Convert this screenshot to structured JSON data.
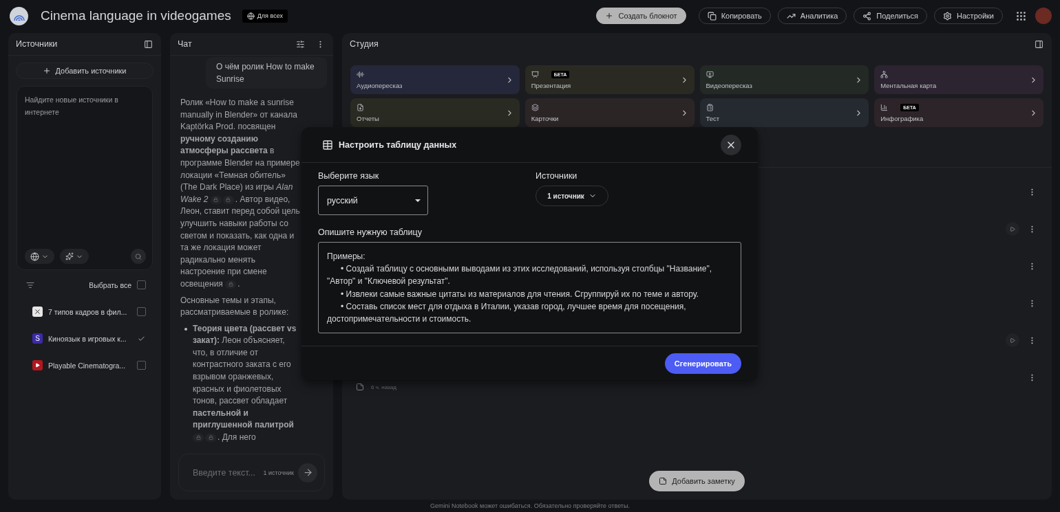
{
  "header": {
    "title": "Cinema language in videogames",
    "visibility": "Для всех",
    "create_button": "Создать блокнот",
    "actions": [
      {
        "kind": "copy",
        "label": "Копировать"
      },
      {
        "kind": "analytics",
        "label": "Аналитика"
      },
      {
        "kind": "share",
        "label": "Поделиться"
      },
      {
        "kind": "settings",
        "label": "Настройки"
      }
    ]
  },
  "sources": {
    "title": "Источники",
    "add_button": "Добавить источники",
    "search_placeholder": "Найдите новые источники в интернете",
    "select_all": {
      "label": "Выбрать все",
      "checked": false
    },
    "items": [
      {
        "kind": "app",
        "title": "7 типов кадров в фил...",
        "checked": false
      },
      {
        "kind": "letter",
        "letter": "S",
        "title": "Киноязык в игровых к...",
        "checked": true
      },
      {
        "kind": "video",
        "title": "Playable Cinematogra...",
        "checked": false
      }
    ]
  },
  "chat": {
    "title": "Чат",
    "question": "О чём ролик How to make Sunrise",
    "blocks": [
      {
        "kind": "paragraph",
        "parts": [
          {
            "kind": "text",
            "text": "Ролик «How to make a sunrise manually in Blender» от канала Kaptörka Prod. посвящен **ручному созданию атмосферы рассвета** в программе Blender на примере локации «Темная обитель» (The Dark Place) из игры *Alan Wake 2* "
          },
          {
            "kind": "citation"
          },
          {
            "kind": "citation"
          },
          {
            "kind": "text",
            "text": ". Автор видео, Леон, ставит перед собой цель улучшить навыки работы со светом и показать, как одна и та же локация может радикально менять настроение при смене освещения "
          },
          {
            "kind": "citation"
          },
          {
            "kind": "text",
            "text": "."
          }
        ]
      },
      {
        "kind": "paragraph",
        "parts": [
          {
            "kind": "text",
            "text": "Основные темы и этапы, рассматриваемые в ролике:"
          }
        ]
      },
      {
        "kind": "bullet",
        "parts": [
          {
            "kind": "text",
            "text": "**Теория цвета (рассвет vs закат):** Леон объясняет, что, в отличие от контрастного заката с его взрывом оранжевых, красных и фиолетовых тонов, рассвет обладает **пастельной и приглушенной палитрой** "
          },
          {
            "kind": "citation"
          },
          {
            "kind": "citation"
          },
          {
            "kind": "text",
            "text": ". Для него"
          }
        ]
      }
    ],
    "input_placeholder": "Введите текст...",
    "source_count": "1 источник"
  },
  "studio": {
    "title": "Студия",
    "tiles": [
      {
        "kind": "audio",
        "label": "Аудиопересказ",
        "color": "#25273a"
      },
      {
        "kind": "slides",
        "label": "Презентация",
        "badge": "БЕТА",
        "color": "#2a2a23"
      },
      {
        "kind": "video",
        "label": "Видеопересказ",
        "color": "#232a26"
      },
      {
        "kind": "mindmap",
        "label": "Ментальная карта",
        "color": "#2c2430"
      },
      {
        "kind": "reports",
        "label": "Отчеты",
        "color": "#292a22"
      },
      {
        "kind": "cards",
        "label": "Карточки",
        "color": "#2c2526"
      },
      {
        "kind": "test",
        "label": "Тест",
        "color": "#252a31"
      },
      {
        "kind": "infographic",
        "label": "Инфографика",
        "badge": "БЕТА",
        "color": "#2c2429"
      }
    ],
    "notes": [
      {
        "play": false
      },
      {
        "play": true
      },
      {
        "play": false
      },
      {
        "play": false
      },
      {
        "play": true
      },
      {
        "play": false,
        "meta": "6 ч. назад"
      }
    ],
    "add_note": "Добавить заметку"
  },
  "dialog": {
    "title": "Настроить таблицу данных",
    "language_label": "Выберите язык",
    "language": "русский",
    "sources_label": "Источники",
    "sources_button": "1 источник",
    "describe_label": "Опишите нужную таблицу",
    "placeholder": "Примеры:\n\t• Создай таблицу с основными выводами из этих исследований, используя столбцы \"Название\", \"Автор\" и \"Ключевой результат\".\n\t• Извлеки самые важные цитаты из материалов для чтения. Сгруппируй их по теме и автору.\n\t• Составь список мест для отдыха в Италии, указав город, лучшее время для посещения, достопримечательности и стоимость.",
    "generate": "Сгенерировать"
  },
  "footer": "Gemini Notebook может ошибаться. Обязательно проверяйте ответы."
}
